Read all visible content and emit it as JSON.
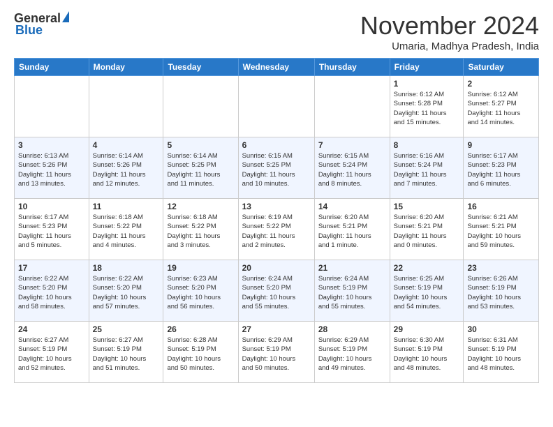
{
  "logo": {
    "general": "General",
    "blue": "Blue"
  },
  "title": "November 2024",
  "location": "Umaria, Madhya Pradesh, India",
  "days_header": [
    "Sunday",
    "Monday",
    "Tuesday",
    "Wednesday",
    "Thursday",
    "Friday",
    "Saturday"
  ],
  "weeks": [
    [
      {
        "day": "",
        "info": ""
      },
      {
        "day": "",
        "info": ""
      },
      {
        "day": "",
        "info": ""
      },
      {
        "day": "",
        "info": ""
      },
      {
        "day": "",
        "info": ""
      },
      {
        "day": "1",
        "info": "Sunrise: 6:12 AM\nSunset: 5:28 PM\nDaylight: 11 hours\nand 15 minutes."
      },
      {
        "day": "2",
        "info": "Sunrise: 6:12 AM\nSunset: 5:27 PM\nDaylight: 11 hours\nand 14 minutes."
      }
    ],
    [
      {
        "day": "3",
        "info": "Sunrise: 6:13 AM\nSunset: 5:26 PM\nDaylight: 11 hours\nand 13 minutes."
      },
      {
        "day": "4",
        "info": "Sunrise: 6:14 AM\nSunset: 5:26 PM\nDaylight: 11 hours\nand 12 minutes."
      },
      {
        "day": "5",
        "info": "Sunrise: 6:14 AM\nSunset: 5:25 PM\nDaylight: 11 hours\nand 11 minutes."
      },
      {
        "day": "6",
        "info": "Sunrise: 6:15 AM\nSunset: 5:25 PM\nDaylight: 11 hours\nand 10 minutes."
      },
      {
        "day": "7",
        "info": "Sunrise: 6:15 AM\nSunset: 5:24 PM\nDaylight: 11 hours\nand 8 minutes."
      },
      {
        "day": "8",
        "info": "Sunrise: 6:16 AM\nSunset: 5:24 PM\nDaylight: 11 hours\nand 7 minutes."
      },
      {
        "day": "9",
        "info": "Sunrise: 6:17 AM\nSunset: 5:23 PM\nDaylight: 11 hours\nand 6 minutes."
      }
    ],
    [
      {
        "day": "10",
        "info": "Sunrise: 6:17 AM\nSunset: 5:23 PM\nDaylight: 11 hours\nand 5 minutes."
      },
      {
        "day": "11",
        "info": "Sunrise: 6:18 AM\nSunset: 5:22 PM\nDaylight: 11 hours\nand 4 minutes."
      },
      {
        "day": "12",
        "info": "Sunrise: 6:18 AM\nSunset: 5:22 PM\nDaylight: 11 hours\nand 3 minutes."
      },
      {
        "day": "13",
        "info": "Sunrise: 6:19 AM\nSunset: 5:22 PM\nDaylight: 11 hours\nand 2 minutes."
      },
      {
        "day": "14",
        "info": "Sunrise: 6:20 AM\nSunset: 5:21 PM\nDaylight: 11 hours\nand 1 minute."
      },
      {
        "day": "15",
        "info": "Sunrise: 6:20 AM\nSunset: 5:21 PM\nDaylight: 11 hours\nand 0 minutes."
      },
      {
        "day": "16",
        "info": "Sunrise: 6:21 AM\nSunset: 5:21 PM\nDaylight: 10 hours\nand 59 minutes."
      }
    ],
    [
      {
        "day": "17",
        "info": "Sunrise: 6:22 AM\nSunset: 5:20 PM\nDaylight: 10 hours\nand 58 minutes."
      },
      {
        "day": "18",
        "info": "Sunrise: 6:22 AM\nSunset: 5:20 PM\nDaylight: 10 hours\nand 57 minutes."
      },
      {
        "day": "19",
        "info": "Sunrise: 6:23 AM\nSunset: 5:20 PM\nDaylight: 10 hours\nand 56 minutes."
      },
      {
        "day": "20",
        "info": "Sunrise: 6:24 AM\nSunset: 5:20 PM\nDaylight: 10 hours\nand 55 minutes."
      },
      {
        "day": "21",
        "info": "Sunrise: 6:24 AM\nSunset: 5:19 PM\nDaylight: 10 hours\nand 55 minutes."
      },
      {
        "day": "22",
        "info": "Sunrise: 6:25 AM\nSunset: 5:19 PM\nDaylight: 10 hours\nand 54 minutes."
      },
      {
        "day": "23",
        "info": "Sunrise: 6:26 AM\nSunset: 5:19 PM\nDaylight: 10 hours\nand 53 minutes."
      }
    ],
    [
      {
        "day": "24",
        "info": "Sunrise: 6:27 AM\nSunset: 5:19 PM\nDaylight: 10 hours\nand 52 minutes."
      },
      {
        "day": "25",
        "info": "Sunrise: 6:27 AM\nSunset: 5:19 PM\nDaylight: 10 hours\nand 51 minutes."
      },
      {
        "day": "26",
        "info": "Sunrise: 6:28 AM\nSunset: 5:19 PM\nDaylight: 10 hours\nand 50 minutes."
      },
      {
        "day": "27",
        "info": "Sunrise: 6:29 AM\nSunset: 5:19 PM\nDaylight: 10 hours\nand 50 minutes."
      },
      {
        "day": "28",
        "info": "Sunrise: 6:29 AM\nSunset: 5:19 PM\nDaylight: 10 hours\nand 49 minutes."
      },
      {
        "day": "29",
        "info": "Sunrise: 6:30 AM\nSunset: 5:19 PM\nDaylight: 10 hours\nand 48 minutes."
      },
      {
        "day": "30",
        "info": "Sunrise: 6:31 AM\nSunset: 5:19 PM\nDaylight: 10 hours\nand 48 minutes."
      }
    ]
  ]
}
